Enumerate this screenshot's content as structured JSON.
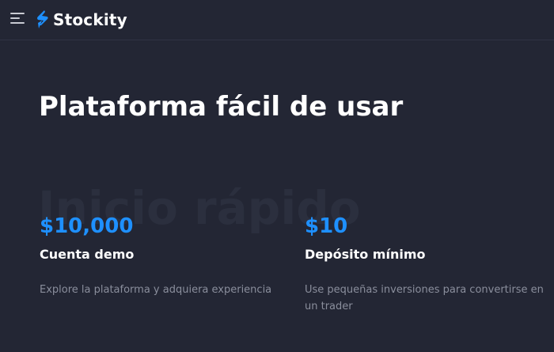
{
  "header": {
    "brand": "Stockity",
    "menu_icon": "hamburger-menu-icon",
    "logo_icon": "stockity-s-logo",
    "accent_color": "#1e90ff"
  },
  "main": {
    "title": "Plataforma fácil de usar",
    "watermark": "Inicio rápido",
    "features": [
      {
        "amount": "$10,000",
        "title": "Cuenta demo",
        "description": "Explore la plataforma y adquiera experiencia"
      },
      {
        "amount": "$10",
        "title": "Depósito mínimo",
        "description": "Use pequeñas inversiones para convertirse en un trader"
      }
    ]
  }
}
